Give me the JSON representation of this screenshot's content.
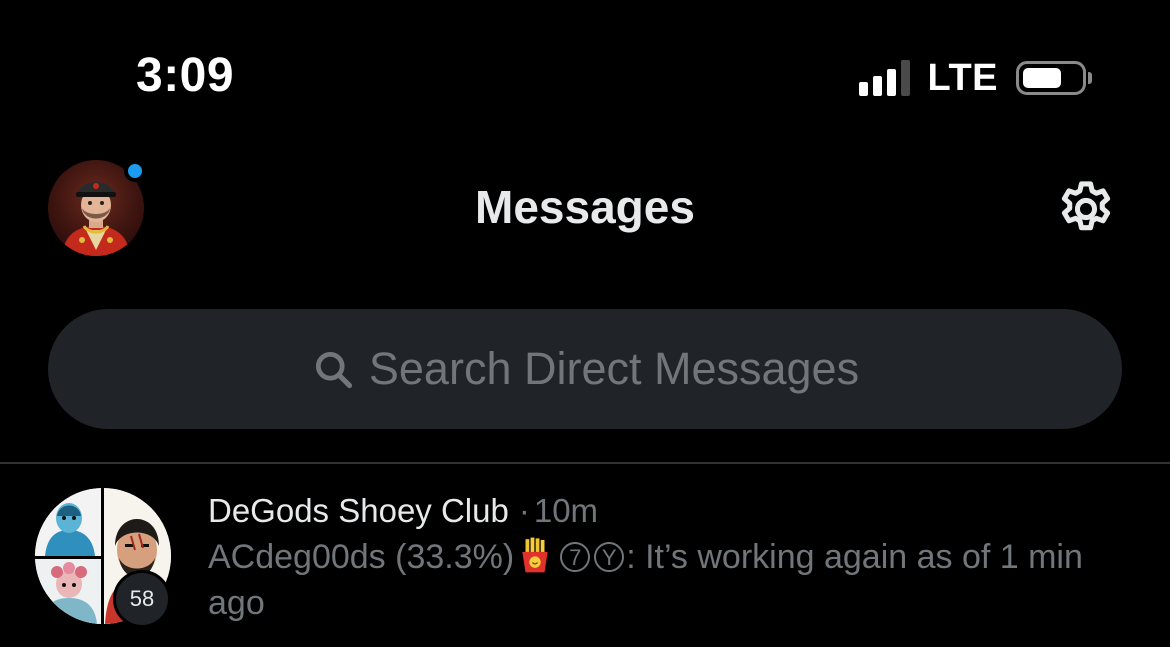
{
  "status_bar": {
    "time": "3:09",
    "network": "LTE",
    "signal_bars": 3,
    "signal_bars_total": 4,
    "battery_level": 0.6
  },
  "header": {
    "title": "Messages",
    "settings_icon": "gear-icon",
    "has_unread_indicator": true
  },
  "search": {
    "icon": "search-icon",
    "placeholder": "Search Direct Messages"
  },
  "conversations": [
    {
      "name": "DeGods Shoey Club",
      "separator": "·",
      "time": "10m",
      "member_count": "58",
      "preview_sender": "ACdeg00ds (33.3%)",
      "preview_icon": "french-fries-icon",
      "preview_badge_1": "7",
      "preview_badge_2": "Y",
      "preview_text": ": It’s working again as of 1 min ago"
    }
  ],
  "colors": {
    "background": "#000000",
    "text_primary": "#e7e9ea",
    "text_secondary": "#71767b",
    "search_bg": "#202327",
    "accent": "#1d9bf0",
    "divider": "#2f3336"
  }
}
